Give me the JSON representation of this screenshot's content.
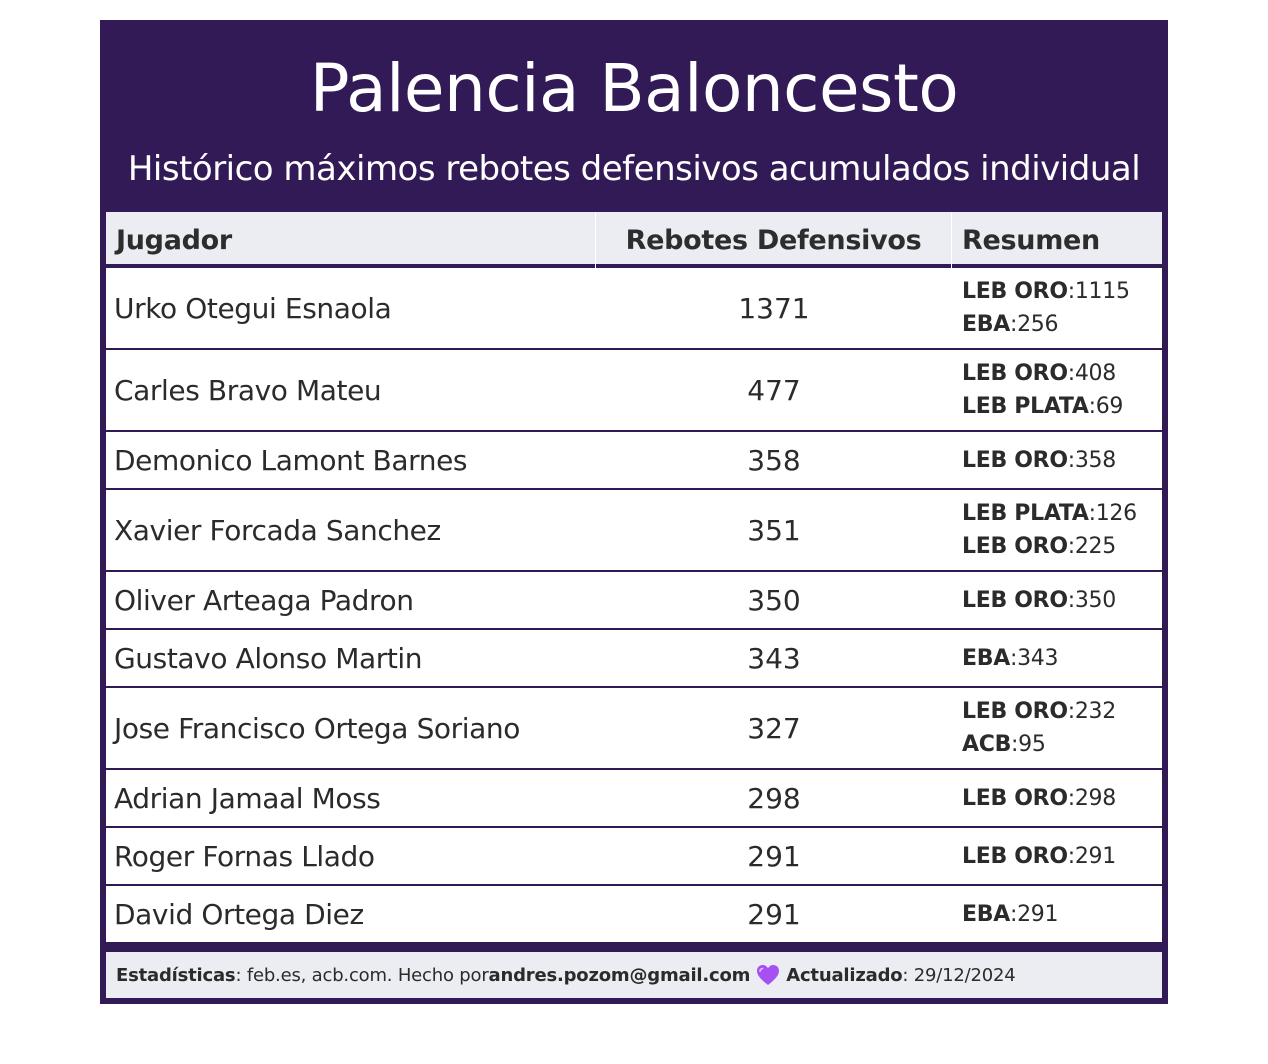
{
  "title": "Palencia Baloncesto",
  "subtitle": "Histórico máximos rebotes defensivos acumulados individual",
  "colors": {
    "header_bg": "#321a57",
    "table_header_bg": "#ecedf2",
    "heart": "#a64ff2"
  },
  "columns": [
    "Jugador",
    "Rebotes Defensivos",
    "Resumen"
  ],
  "rows": [
    {
      "player": "Urko Otegui Esnaola",
      "total": "1371",
      "summary": [
        {
          "league": "LEB ORO",
          "value": "1115"
        },
        {
          "league": "EBA",
          "value": "256"
        }
      ]
    },
    {
      "player": "Carles Bravo Mateu",
      "total": "477",
      "summary": [
        {
          "league": "LEB ORO",
          "value": "408"
        },
        {
          "league": "LEB PLATA",
          "value": "69"
        }
      ]
    },
    {
      "player": "Demonico Lamont Barnes",
      "total": "358",
      "summary": [
        {
          "league": "LEB ORO",
          "value": "358"
        }
      ]
    },
    {
      "player": "Xavier Forcada Sanchez",
      "total": "351",
      "summary": [
        {
          "league": "LEB PLATA",
          "value": "126"
        },
        {
          "league": "LEB ORO",
          "value": "225"
        }
      ]
    },
    {
      "player": "Oliver Arteaga Padron",
      "total": "350",
      "summary": [
        {
          "league": "LEB ORO",
          "value": "350"
        }
      ]
    },
    {
      "player": "Gustavo Alonso Martin",
      "total": "343",
      "summary": [
        {
          "league": "EBA",
          "value": "343"
        }
      ]
    },
    {
      "player": "Jose Francisco Ortega Soriano",
      "total": "327",
      "summary": [
        {
          "league": "LEB ORO",
          "value": "232"
        },
        {
          "league": "ACB",
          "value": "95"
        }
      ]
    },
    {
      "player": "Adrian Jamaal Moss",
      "total": "298",
      "summary": [
        {
          "league": "LEB ORO",
          "value": "298"
        }
      ]
    },
    {
      "player": "Roger Fornas Llado",
      "total": "291",
      "summary": [
        {
          "league": "LEB ORO",
          "value": "291"
        }
      ]
    },
    {
      "player": "David Ortega Diez",
      "total": "291",
      "summary": [
        {
          "league": "EBA",
          "value": "291"
        }
      ]
    }
  ],
  "footer": {
    "stats_label": "Estadísticas",
    "stats_sources": ": feb.es, acb.com. Hecho por ",
    "author": "andres.pozom@gmail.com",
    "heart_icon": "purple-heart",
    "updated_label": "Actualizado",
    "updated_date": ": 29/12/2024"
  }
}
